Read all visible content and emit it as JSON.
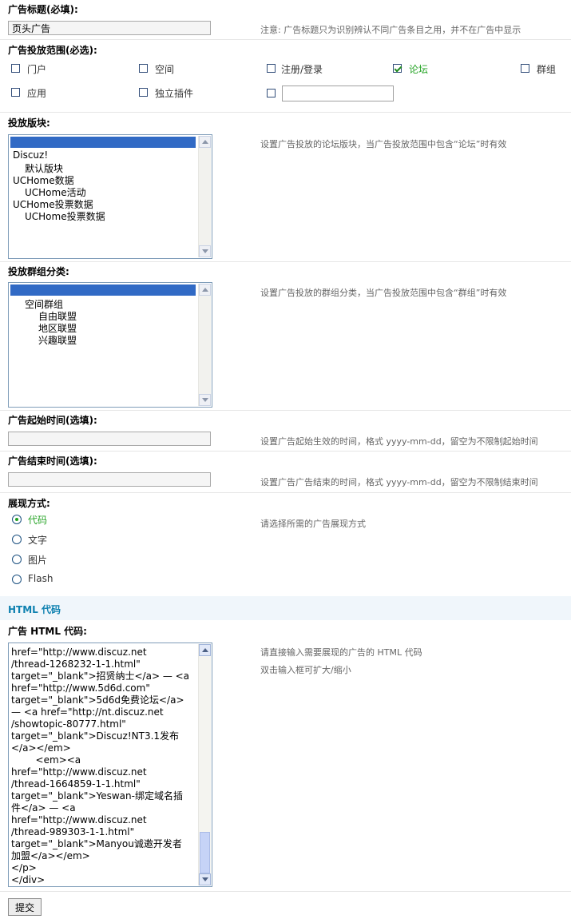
{
  "ad_title": {
    "label": "广告标题(必填):",
    "value": "页头广告",
    "tip": "注意: 广告标题只为识别辨认不同广告条目之用，并不在广告中显示"
  },
  "ad_scope": {
    "label": "广告投放范围(必选):",
    "options": [
      {
        "label": "门户",
        "checked": false
      },
      {
        "label": "空间",
        "checked": false
      },
      {
        "label": "注册/登录",
        "checked": false
      },
      {
        "label": "论坛",
        "checked": true
      },
      {
        "label": "群组",
        "checked": false
      },
      {
        "label": "应用",
        "checked": false
      },
      {
        "label": "独立插件",
        "checked": false
      }
    ],
    "custom_value": ""
  },
  "forum_block": {
    "label": "投放版块:",
    "tip": "设置广告投放的论坛版块，当广告投放范围中包含“论坛”时有效",
    "options": [
      "Discuz!",
      "默认版块",
      "UCHome数据",
      "UCHome活动",
      "UCHome投票数据",
      "UCHome投票数据"
    ]
  },
  "group_category": {
    "label": "投放群组分类:",
    "tip": "设置广告投放的群组分类，当广告投放范围中包含“群组”时有效",
    "options": [
      "空间群组",
      "自由联盟",
      "地区联盟",
      "兴趣联盟"
    ]
  },
  "start_time": {
    "label": "广告起始时间(选填):",
    "value": "",
    "tip": "设置广告起始生效的时间，格式 yyyy-mm-dd，留空为不限制起始时间"
  },
  "end_time": {
    "label": "广告结束时间(选填):",
    "value": "",
    "tip": "设置广告广告结束的时间，格式 yyyy-mm-dd，留空为不限制结束时间"
  },
  "display_mode": {
    "label": "展现方式:",
    "tip": "请选择所需的广告展现方式",
    "options": [
      {
        "label": "代码",
        "selected": true
      },
      {
        "label": "文字",
        "selected": false
      },
      {
        "label": "图片",
        "selected": false
      },
      {
        "label": "Flash",
        "selected": false
      }
    ]
  },
  "html_section": {
    "heading": "HTML 代码",
    "label": "广告 HTML 代码:",
    "tip1": "请直接输入需要展现的广告的 HTML 代码",
    "tip2": "双击输入框可扩大/缩小",
    "code_lines": [
      "href=\"http://www.discuz.net",
      "/thread-1268232-1-1.html\"",
      "target=\"_blank\">招贤纳士</a> — <a",
      "href=\"http://www.5d6d.com\"",
      "target=\"_blank\">5d6d免费论坛</a>",
      "— <a href=\"http://nt.discuz.net",
      "/showtopic-80777.html\"",
      "target=\"_blank\">Discuz!NT3.1发布",
      "</a></em>",
      "        <em><a",
      "href=\"http://www.discuz.net",
      "/thread-1664859-1-1.html\"",
      "target=\"_blank\">Yeswan-绑定域名插",
      "件</a> — <a",
      "href=\"http://www.discuz.net",
      "/thread-989303-1-1.html\"",
      "target=\"_blank\">Manyou诚邀开发者",
      "加盟</a></em>",
      "</p>",
      "</div>"
    ]
  },
  "submit_label": "提交"
}
